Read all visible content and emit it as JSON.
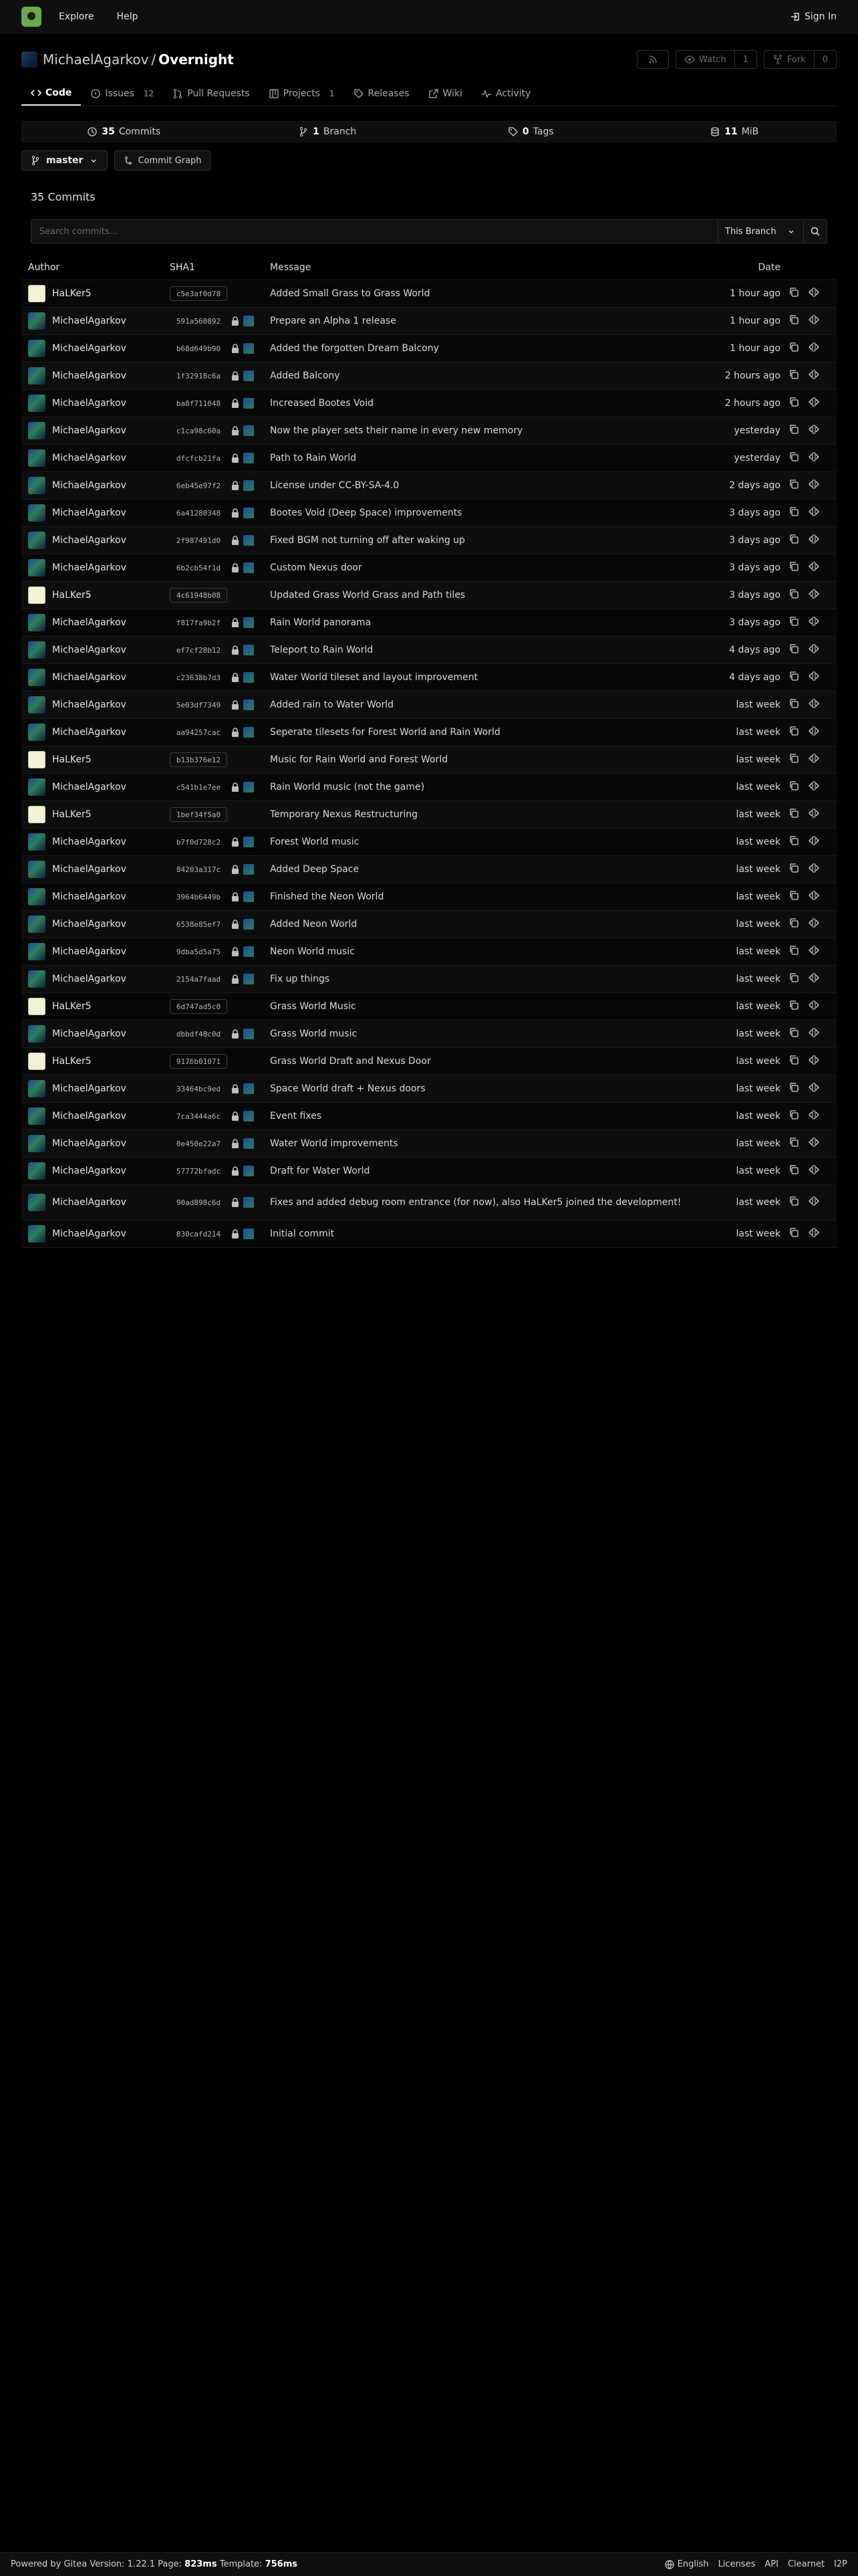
{
  "nav": {
    "explore": "Explore",
    "help": "Help",
    "sign_in": "Sign In"
  },
  "repo": {
    "owner": "MichaelAgarkov",
    "separator": "/",
    "name": "Overnight",
    "watch_label": "Watch",
    "watch_count": "1",
    "fork_label": "Fork",
    "fork_count": "0"
  },
  "tabs": {
    "code": "Code",
    "issues": "Issues",
    "issues_count": "12",
    "pulls": "Pull Requests",
    "projects": "Projects",
    "projects_count": "1",
    "releases": "Releases",
    "wiki": "Wiki",
    "activity": "Activity"
  },
  "stats": {
    "commits_num": "35",
    "commits_label": "Commits",
    "branch_num": "1",
    "branch_label": "Branch",
    "tags_num": "0",
    "tags_label": "Tags",
    "size_num": "11",
    "size_label": "MiB"
  },
  "branch": {
    "name": "master",
    "graph": "Commit Graph"
  },
  "commits_heading": "35 Commits",
  "search": {
    "placeholder": "Search commits...",
    "scope": "This Branch"
  },
  "columns": {
    "author": "Author",
    "sha": "SHA1",
    "message": "Message",
    "date": "Date"
  },
  "commits": [
    {
      "author": "HaLKer5",
      "sha": "c5e3af0d78",
      "message": "Added Small Grass to Grass World",
      "date": "1 hour ago"
    },
    {
      "author": "MichaelAgarkov",
      "sha": "591a560892",
      "message": "Prepare an Alpha 1 release",
      "date": "1 hour ago"
    },
    {
      "author": "MichaelAgarkov",
      "sha": "b68d649b90",
      "message": "Added the forgotten Dream Balcony",
      "date": "1 hour ago"
    },
    {
      "author": "MichaelAgarkov",
      "sha": "1f32918c6a",
      "message": "Added Balcony",
      "date": "2 hours ago"
    },
    {
      "author": "MichaelAgarkov",
      "sha": "ba8f711048",
      "message": "Increased Bootes Void",
      "date": "2 hours ago"
    },
    {
      "author": "MichaelAgarkov",
      "sha": "c1ca98c60a",
      "message": "Now the player sets their name in every new memory",
      "date": "yesterday"
    },
    {
      "author": "MichaelAgarkov",
      "sha": "dfcfcb21fa",
      "message": "Path to Rain World",
      "date": "yesterday"
    },
    {
      "author": "MichaelAgarkov",
      "sha": "6eb45e97f2",
      "message": "License under CC-BY-SA-4.0",
      "date": "2 days ago"
    },
    {
      "author": "MichaelAgarkov",
      "sha": "6a41280348",
      "message": "Bootes Void (Deep Space) improvements",
      "date": "3 days ago"
    },
    {
      "author": "MichaelAgarkov",
      "sha": "2f987491d0",
      "message": "Fixed BGM not turning off after waking up",
      "date": "3 days ago"
    },
    {
      "author": "MichaelAgarkov",
      "sha": "6b2cb54f1d",
      "message": "Custom Nexus door",
      "date": "3 days ago"
    },
    {
      "author": "HaLKer5",
      "sha": "4c61948b08",
      "message": "Updated Grass World Grass and Path tiles",
      "date": "3 days ago"
    },
    {
      "author": "MichaelAgarkov",
      "sha": "f817fa9b2f",
      "message": "Rain World panorama",
      "date": "3 days ago"
    },
    {
      "author": "MichaelAgarkov",
      "sha": "ef7cf28b12",
      "message": "Teleport to Rain World",
      "date": "4 days ago"
    },
    {
      "author": "MichaelAgarkov",
      "sha": "c23638b7d3",
      "message": "Water World tileset and layout improvement",
      "date": "4 days ago"
    },
    {
      "author": "MichaelAgarkov",
      "sha": "5e03df7349",
      "message": "Added rain to Water World",
      "date": "last week"
    },
    {
      "author": "MichaelAgarkov",
      "sha": "aa94257cac",
      "message": "Seperate tilesets for Forest World and Rain World",
      "date": "last week"
    },
    {
      "author": "HaLKer5",
      "sha": "b13b376e12",
      "message": "Music for Rain World and Forest World",
      "date": "last week"
    },
    {
      "author": "MichaelAgarkov",
      "sha": "c541b1e7ee",
      "message": "Rain World music (not the game)",
      "date": "last week"
    },
    {
      "author": "HaLKer5",
      "sha": "1bef34f5a0",
      "message": "Temporary Nexus Restructuring",
      "date": "last week"
    },
    {
      "author": "MichaelAgarkov",
      "sha": "b7f0d728c2",
      "message": "Forest World music",
      "date": "last week"
    },
    {
      "author": "MichaelAgarkov",
      "sha": "84203a317c",
      "message": "Added Deep Space",
      "date": "last week"
    },
    {
      "author": "MichaelAgarkov",
      "sha": "3964b6449b",
      "message": "Finished the Neon World",
      "date": "last week"
    },
    {
      "author": "MichaelAgarkov",
      "sha": "6538e85ef7",
      "message": "Added Neon World",
      "date": "last week"
    },
    {
      "author": "MichaelAgarkov",
      "sha": "9dba5d5a75",
      "message": "Neon World music",
      "date": "last week"
    },
    {
      "author": "MichaelAgarkov",
      "sha": "2154a7faad",
      "message": "Fix up things",
      "date": "last week"
    },
    {
      "author": "HaLKer5",
      "sha": "6d747ad5c0",
      "message": "Grass World Music",
      "date": "last week"
    },
    {
      "author": "MichaelAgarkov",
      "sha": "dbbdf48c0d",
      "message": "Grass World music",
      "date": "last week"
    },
    {
      "author": "HaLKer5",
      "sha": "9176b01071",
      "message": "Grass World Draft and Nexus Door",
      "date": "last week"
    },
    {
      "author": "MichaelAgarkov",
      "sha": "33464bc9ed",
      "message": "Space World draft + Nexus doors",
      "date": "last week"
    },
    {
      "author": "MichaelAgarkov",
      "sha": "7ca3444a6c",
      "message": "Event fixes",
      "date": "last week"
    },
    {
      "author": "MichaelAgarkov",
      "sha": "0e450e22a7",
      "message": "Water World improvements",
      "date": "last week"
    },
    {
      "author": "MichaelAgarkov",
      "sha": "57772bfadc",
      "message": "Draft for Water World",
      "date": "last week"
    },
    {
      "author": "MichaelAgarkov",
      "sha": "90ad898c6d",
      "message": "Fixes and added debug room entrance (for now), also HaLKer5 joined the development!",
      "date": "last week"
    },
    {
      "author": "MichaelAgarkov",
      "sha": "830cafd214",
      "message": "Initial commit",
      "date": "last week"
    }
  ],
  "footer": {
    "powered": "Powered by Gitea Version: 1.22.1 Page:",
    "page_time": "823ms",
    "template_label": "Template:",
    "template_time": "756ms",
    "language": "English",
    "licenses": "Licenses",
    "api": "API",
    "clearnet": "Clearnet",
    "i2p": "I2P"
  }
}
